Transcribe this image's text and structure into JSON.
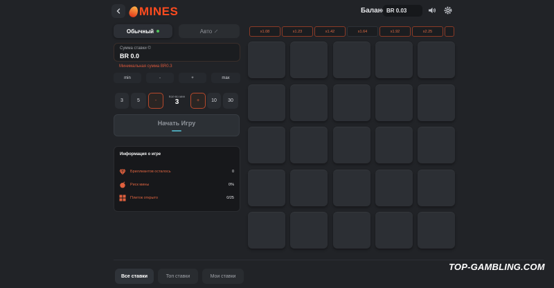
{
  "header": {
    "back_icon": "chevron-left-icon",
    "logo_text": "MINES",
    "balance_label": "Баланс:",
    "balance_value": "BR 0.03",
    "sound_icon": "speaker-icon",
    "settings_icon": "gear-icon"
  },
  "mode_tabs": [
    {
      "label": "Обычный",
      "active": true
    },
    {
      "label": "Авто",
      "active": false
    }
  ],
  "bet": {
    "label": "Сумма ставки ©",
    "value": "BR 0.0",
    "min_note": "Минимальная сумма BR0.3"
  },
  "quick_buttons": [
    "min",
    "-",
    "+",
    "max"
  ],
  "mines": {
    "left_buttons": [
      "3",
      "5",
      "-"
    ],
    "count_label": "Кол-во мин",
    "count_value": "3",
    "right_buttons": [
      "+",
      "10",
      "30"
    ]
  },
  "start_button": {
    "label": "Начать Игру"
  },
  "info": {
    "title": "Информация о игре",
    "rows": [
      {
        "icon": "diamond-icon",
        "label": "Бриллиантов осталось",
        "value": "0"
      },
      {
        "icon": "mine-icon",
        "label": "Риск мины",
        "value": "0%"
      },
      {
        "icon": "grid-icon",
        "label": "Плиток открыто",
        "value": "0/25"
      }
    ]
  },
  "multipliers": [
    "x1.08",
    "x1.23",
    "x1.42",
    "x1.64",
    "x1.92",
    "x2.25"
  ],
  "grid": {
    "rows": 5,
    "cols": 5
  },
  "bottom_tabs": [
    {
      "label": "Все ставки",
      "active": true
    },
    {
      "label": "Топ ставки",
      "active": false
    },
    {
      "label": "Мои ставки",
      "active": false
    }
  ],
  "watermark": "TOP-GAMBLING.COM",
  "colors": {
    "accent": "#e0603e",
    "background": "#212327",
    "tile": "#2c2f34",
    "active_dot": "#4fc35a"
  }
}
